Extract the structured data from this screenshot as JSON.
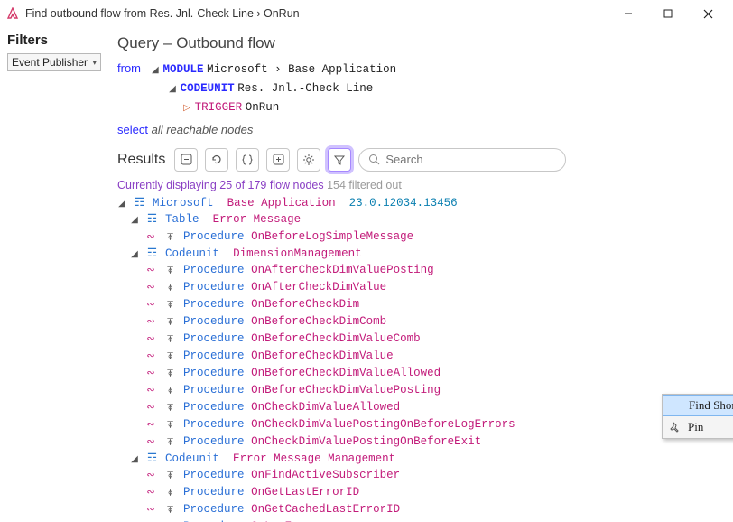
{
  "window": {
    "title": "Find outbound flow from Res. Jnl.-Check Line › OnRun"
  },
  "sidebar": {
    "heading": "Filters",
    "dropdown_label": "Event Publisher"
  },
  "query": {
    "title": "Query – Outbound flow",
    "from_kw": "from",
    "module_kw": "MODULE",
    "module_path": "Microsoft › Base Application",
    "codeunit_kw": "CODEUNIT",
    "codeunit_name": "Res. Jnl.-Check Line",
    "trigger_kw": "TRIGGER",
    "trigger_name": "OnRun",
    "select_kw": "select",
    "select_expr": "all reachable nodes"
  },
  "results": {
    "heading": "Results",
    "search_placeholder": "Search",
    "summary_prefix": "Currently displaying 25 of 179 flow nodes",
    "summary_suffix": "154 filtered out"
  },
  "tree": {
    "root": {
      "type": "Microsoft",
      "name": "Base Application",
      "version": "23.0.12034.13456"
    },
    "group1": {
      "type": "Table",
      "name": "Error Message"
    },
    "group1_items": [
      {
        "type": "Procedure",
        "name": "OnBeforeLogSimpleMessage"
      }
    ],
    "group2": {
      "type": "Codeunit",
      "name": "DimensionManagement"
    },
    "group2_items": [
      {
        "type": "Procedure",
        "name": "OnAfterCheckDimValuePosting"
      },
      {
        "type": "Procedure",
        "name": "OnAfterCheckDimValue"
      },
      {
        "type": "Procedure",
        "name": "OnBeforeCheckDim"
      },
      {
        "type": "Procedure",
        "name": "OnBeforeCheckDimComb"
      },
      {
        "type": "Procedure",
        "name": "OnBeforeCheckDimValueComb"
      },
      {
        "type": "Procedure",
        "name": "OnBeforeCheckDimValue"
      },
      {
        "type": "Procedure",
        "name": "OnBeforeCheckDimValueAllowed"
      },
      {
        "type": "Procedure",
        "name": "OnBeforeCheckDimValuePosting"
      },
      {
        "type": "Procedure",
        "name": "OnCheckDimValueAllowed"
      },
      {
        "type": "Procedure",
        "name": "OnCheckDimValuePostingOnBeforeLogErrors"
      },
      {
        "type": "Procedure",
        "name": "OnCheckDimValuePostingOnBeforeExit"
      }
    ],
    "group3": {
      "type": "Codeunit",
      "name": "Error Message Management"
    },
    "group3_items": [
      {
        "type": "Procedure",
        "name": "OnFindActiveSubscriber"
      },
      {
        "type": "Procedure",
        "name": "OnGetLastErrorID"
      },
      {
        "type": "Procedure",
        "name": "OnGetCachedLastErrorID"
      },
      {
        "type": "Procedure",
        "name": "OnLogError"
      }
    ]
  },
  "context_menu": {
    "item1": "Find Shortest Path",
    "item2": "Pin"
  }
}
